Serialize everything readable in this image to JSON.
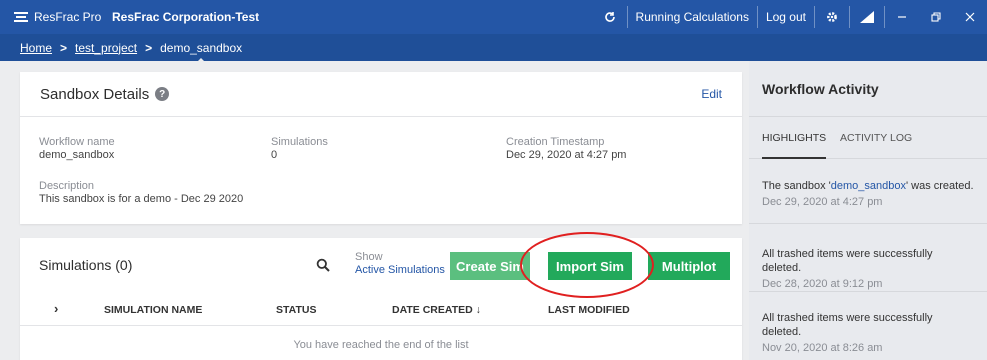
{
  "topbar": {
    "app_name": "ResFrac Pro",
    "company": "ResFrac Corporation-Test",
    "running_calculations": "Running Calculations",
    "logout": "Log out"
  },
  "breadcrumb": {
    "home": "Home",
    "project": "test_project",
    "current": "demo_sandbox"
  },
  "sandbox_details": {
    "title": "Sandbox Details",
    "edit_label": "Edit",
    "workflow_name_label": "Workflow name",
    "workflow_name_value": "demo_sandbox",
    "simulations_label": "Simulations",
    "simulations_value": "0",
    "creation_label": "Creation Timestamp",
    "creation_value": "Dec 29, 2020 at 4:27 pm",
    "description_label": "Description",
    "description_value": "This sandbox is for a demo - Dec 29 2020"
  },
  "simulations": {
    "title": "Simulations (0)",
    "show_label": "Show",
    "show_value": "Active Simulations",
    "create_button": "Create Sim",
    "import_button": "Import Sim",
    "multiplot_button": "Multiplot",
    "columns": {
      "expand": "›",
      "name": "SIMULATION NAME",
      "status": "STATUS",
      "date_created": "DATE CREATED",
      "last_modified": "LAST MODIFIED"
    },
    "end_message": "You have reached the end of the list"
  },
  "workflow_activity": {
    "title": "Workflow Activity",
    "tabs": [
      "HIGHLIGHTS",
      "ACTIVITY LOG"
    ],
    "items": [
      {
        "pre": "The sandbox '",
        "link": "demo_sandbox",
        "post": "' was created.",
        "time": "Dec 29, 2020 at 4:27 pm"
      },
      {
        "pre": "All trashed items were successfully deleted.",
        "link": "",
        "post": "",
        "time": "Dec 28, 2020 at 9:12 pm"
      },
      {
        "pre": "All trashed items were successfully deleted.",
        "link": "",
        "post": "",
        "time": "Nov 20, 2020 at 8:26 am"
      }
    ]
  },
  "icons": [
    "menu-logo-icon",
    "refresh-icon",
    "gear-icon",
    "signal-icon",
    "minimize-icon",
    "restore-icon",
    "close-icon",
    "help-icon",
    "search-icon",
    "sort-down-arrow-icon",
    "chevron-right-icon"
  ],
  "colors": {
    "topbar": "#2456a6",
    "crumbbar": "#1f4f98",
    "button_green": "#22a95b",
    "highlight_ring": "#e02020"
  }
}
